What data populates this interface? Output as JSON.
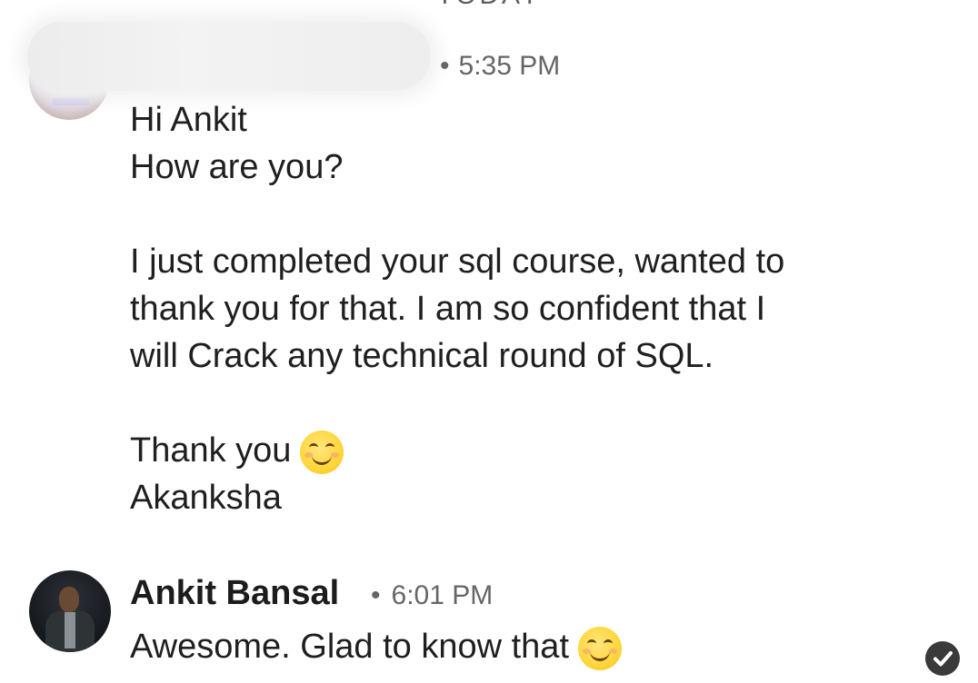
{
  "divider": {
    "label": "TODAY"
  },
  "messages": [
    {
      "sender": "",
      "time": "5:35 PM",
      "lines_block_1": [
        "Hi Ankit",
        "How are you?"
      ],
      "lines_block_2": [
        "I just completed your sql course, wanted to",
        "thank you for that. I am so confident that I",
        "will Crack any technical round of SQL."
      ],
      "lines_block_3": [
        "Thank you",
        "Akanksha"
      ],
      "emoji": "smiling-face-icon"
    },
    {
      "sender": "Ankit Bansal",
      "time": "6:01 PM",
      "text": "Awesome. Glad to know that",
      "emoji": "smiling-face-icon",
      "status": "read"
    }
  ],
  "separator": "•"
}
